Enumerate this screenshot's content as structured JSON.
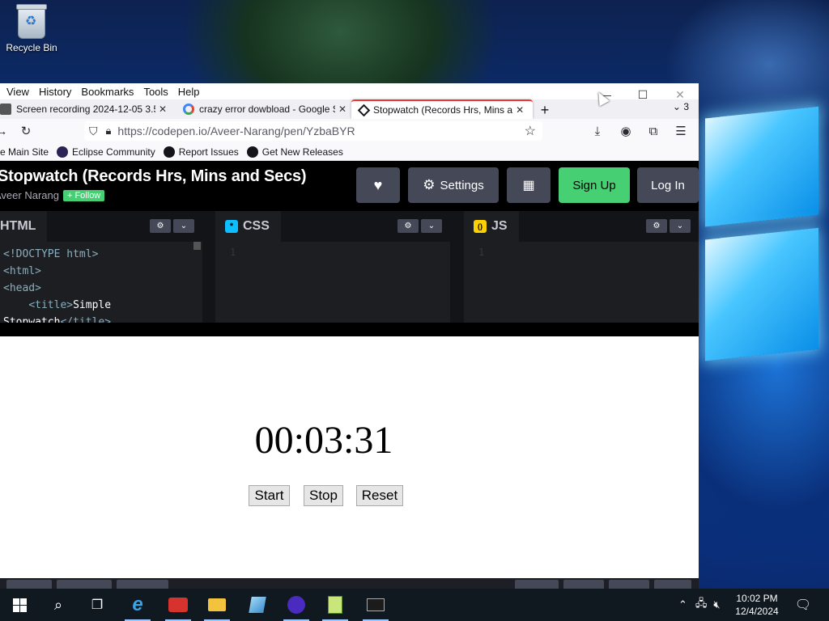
{
  "desktop": {
    "recycle_bin_label": "Recycle Bin"
  },
  "browser": {
    "menu": [
      {
        "label": "View",
        "underline": "V"
      },
      {
        "label": "History",
        "underline": "S"
      },
      {
        "label": "Bookmarks",
        "underline": "B"
      },
      {
        "label": "Tools",
        "underline": "T"
      },
      {
        "label": "Help",
        "underline": "H"
      }
    ],
    "tabs": [
      {
        "title": "Screen recording 2024-12-05 3.5",
        "active": false
      },
      {
        "title": "crazy error dowbload - Google S",
        "active": false
      },
      {
        "title": "Stopwatch (Records Hrs, Mins a",
        "active": true
      }
    ],
    "tab_count": "3",
    "url": "https://codepen.io/Aveer-Narang/pen/YzbaBYR",
    "url_host": "codepen.io",
    "bookmarks": [
      {
        "label": "e Main Site",
        "icon": "site-icon",
        "color": "#f5a623"
      },
      {
        "label": "Eclipse Community",
        "icon": "eclipse-icon",
        "color": "#2c2255"
      },
      {
        "label": "Report Issues",
        "icon": "github-icon",
        "color": "#15141a"
      },
      {
        "label": "Get New Releases",
        "icon": "github-icon",
        "color": "#15141a"
      }
    ]
  },
  "codepen": {
    "title": "Stopwatch (Records Hrs, Mins and Secs)",
    "author": "Aveer Narang",
    "follow_label": "+ Follow",
    "buttons": {
      "settings": "Settings",
      "signup": "Sign Up",
      "login": "Log In"
    },
    "editors": [
      {
        "lang": "HTML",
        "badge": ""
      },
      {
        "lang": "CSS",
        "badge": "*",
        "badge_color": "#0ebeff"
      },
      {
        "lang": "JS",
        "badge": "()",
        "badge_color": "#fcd000"
      }
    ],
    "html_code": {
      "line1": "<!DOCTYPE html>",
      "line2": "<html>",
      "line3": "<head>",
      "line4_tag": "<title>",
      "line4_text": "Simple",
      "line5_text": "Stopwatch",
      "line5_tag": "</title>"
    },
    "css_line_no": "1",
    "js_line_no": "1",
    "preview": {
      "time": "00:03:31",
      "start": "Start",
      "stop": "Stop",
      "reset": "Reset"
    }
  },
  "taskbar": {
    "clock_time": "10:02 PM",
    "clock_date": "12/4/2024"
  },
  "colors": {
    "codepen_green": "#47cf73",
    "codepen_button": "#444857",
    "active_tab_accent": "#e33"
  }
}
